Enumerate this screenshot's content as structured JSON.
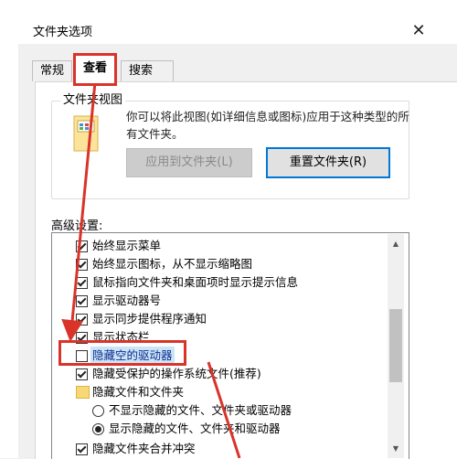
{
  "window": {
    "title": "文件夹选项",
    "close_icon": "close-icon"
  },
  "tabs": [
    {
      "label": "常规"
    },
    {
      "label": "查看"
    },
    {
      "label": "搜索"
    }
  ],
  "folder_view": {
    "title": "文件夹视图",
    "description": "你可以将此视图(如详细信息或图标)应用于这种类型的所有文件夹。",
    "apply_button": "应用到文件夹(L)",
    "reset_button": "重置文件夹(R)"
  },
  "advanced": {
    "label": "高级设置:",
    "items": [
      {
        "type": "checkbox",
        "checked": true,
        "label": "始终显示菜单"
      },
      {
        "type": "checkbox",
        "checked": true,
        "label": "始终显示图标，从不显示缩略图"
      },
      {
        "type": "checkbox",
        "checked": true,
        "label": "鼠标指向文件夹和桌面项时显示提示信息"
      },
      {
        "type": "checkbox",
        "checked": true,
        "label": "显示驱动器号"
      },
      {
        "type": "checkbox",
        "checked": true,
        "label": "显示同步提供程序通知"
      },
      {
        "type": "checkbox",
        "checked": true,
        "label": "显示状态栏"
      },
      {
        "type": "checkbox",
        "checked": false,
        "label": "隐藏空的驱动器"
      },
      {
        "type": "checkbox",
        "checked": true,
        "label": "隐藏受保护的操作系统文件(推荐)"
      },
      {
        "type": "folder",
        "label": "隐藏文件和文件夹"
      },
      {
        "type": "radio",
        "checked": false,
        "label": "不显示隐藏的文件、文件夹或驱动器"
      },
      {
        "type": "radio",
        "checked": true,
        "label": "显示隐藏的文件、文件夹和驱动器"
      },
      {
        "type": "checkbox",
        "checked": true,
        "label": "隐藏文件夹合并冲突"
      }
    ]
  },
  "colors": {
    "highlight_red": "#d8342a",
    "selection": "#cce4f7",
    "accent": "#0078d7"
  }
}
